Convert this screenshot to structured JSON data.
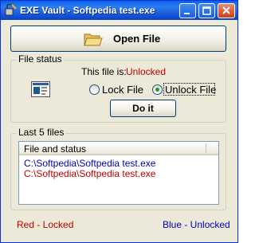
{
  "window": {
    "title": "EXE Vault - Softpedia test.exe"
  },
  "toolbar": {
    "open_label": "Open File"
  },
  "file_status": {
    "group_label": "File status",
    "this_file_label": "This file is:",
    "status_value": "Unlocked",
    "lock_label": "Lock File",
    "unlock_label": "Unlock File",
    "selected_option": "unlock",
    "do_it_label": "Do it"
  },
  "last_files": {
    "group_label": "Last 5 files",
    "column_header": "File and status",
    "rows": [
      {
        "path": "C:\\Softpedia\\Softpedia test.exe",
        "status": "unlocked",
        "color": "#0000c0"
      },
      {
        "path": "C:\\Softpedia\\Softpedia test.exe",
        "status": "locked",
        "color": "#c00000"
      }
    ]
  },
  "legend": {
    "red_label": "Red - Locked",
    "blue_label": "Blue - Unlocked",
    "red_color": "#c00000",
    "blue_color": "#0000c0"
  },
  "icons": {
    "app": "vault-app-icon",
    "open": "folder-icon",
    "file": "exe-file-icon"
  }
}
